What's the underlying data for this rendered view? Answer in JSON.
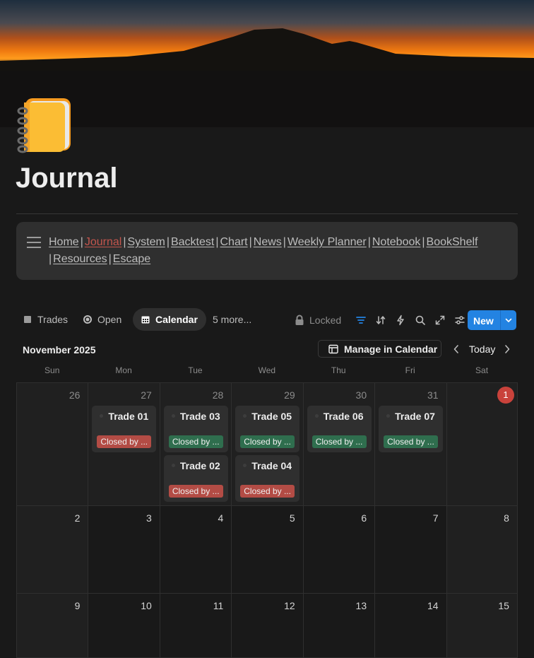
{
  "page": {
    "title": "Journal",
    "icon": "spiral-notebook-icon"
  },
  "nav_links": [
    {
      "label": "Home",
      "active": false
    },
    {
      "label": "Journal",
      "active": true
    },
    {
      "label": "System",
      "active": false
    },
    {
      "label": "Backtest",
      "active": false
    },
    {
      "label": "Chart",
      "active": false
    },
    {
      "label": "News",
      "active": false
    },
    {
      "label": "Weekly Planner",
      "active": false
    },
    {
      "label": "Notebook",
      "active": false
    },
    {
      "label": "BookShelf",
      "active": false
    },
    {
      "label": "Resources",
      "active": false
    },
    {
      "label": "Escape",
      "active": false
    }
  ],
  "nav_separator": "|",
  "views": {
    "tabs": [
      {
        "label": "Trades",
        "icon": "square-icon",
        "active": false
      },
      {
        "label": "Open",
        "icon": "circle-icon",
        "active": false
      },
      {
        "label": "Calendar",
        "icon": "calendar-icon",
        "active": true
      }
    ],
    "more_label": "5 more...",
    "locked_label": "Locked",
    "new_label": "New"
  },
  "calendar": {
    "month_label": "November 2025",
    "manage_label": "Manage in Calendar",
    "today_label": "Today",
    "weekdays": [
      "Sun",
      "Mon",
      "Tue",
      "Wed",
      "Thu",
      "Fri",
      "Sat"
    ],
    "weeks": [
      [
        {
          "day": "26",
          "muted": true,
          "today": false,
          "trades": []
        },
        {
          "day": "27",
          "muted": true,
          "today": false,
          "trades": [
            {
              "title": "Trade 01",
              "status": "Closed by ...",
              "status_color": "#b34c45"
            }
          ]
        },
        {
          "day": "28",
          "muted": true,
          "today": false,
          "trades": [
            {
              "title": "Trade 03",
              "status": "Closed by ...",
              "status_color": "#2f6e4e"
            },
            {
              "title": "Trade 02",
              "status": "Closed by ...",
              "status_color": "#b34c45"
            }
          ]
        },
        {
          "day": "29",
          "muted": true,
          "today": false,
          "trades": [
            {
              "title": "Trade 05",
              "status": "Closed by ...",
              "status_color": "#2f6e4e"
            },
            {
              "title": "Trade 04",
              "status": "Closed by ...",
              "status_color": "#b34c45"
            }
          ]
        },
        {
          "day": "30",
          "muted": true,
          "today": false,
          "trades": [
            {
              "title": "Trade 06",
              "status": "Closed by ...",
              "status_color": "#2f6e4e"
            }
          ]
        },
        {
          "day": "31",
          "muted": true,
          "today": false,
          "trades": [
            {
              "title": "Trade 07",
              "status": "Closed by ...",
              "status_color": "#2f6e4e"
            }
          ]
        },
        {
          "day": "1",
          "muted": false,
          "today": true,
          "trades": []
        }
      ],
      [
        {
          "day": "2",
          "muted": false,
          "today": false,
          "trades": []
        },
        {
          "day": "3",
          "muted": false,
          "today": false,
          "trades": []
        },
        {
          "day": "4",
          "muted": false,
          "today": false,
          "trades": []
        },
        {
          "day": "5",
          "muted": false,
          "today": false,
          "trades": []
        },
        {
          "day": "6",
          "muted": false,
          "today": false,
          "trades": []
        },
        {
          "day": "7",
          "muted": false,
          "today": false,
          "trades": []
        },
        {
          "day": "8",
          "muted": false,
          "today": false,
          "trades": []
        }
      ],
      [
        {
          "day": "9",
          "muted": false,
          "today": false,
          "trades": []
        },
        {
          "day": "10",
          "muted": false,
          "today": false,
          "trades": []
        },
        {
          "day": "11",
          "muted": false,
          "today": false,
          "trades": []
        },
        {
          "day": "12",
          "muted": false,
          "today": false,
          "trades": []
        },
        {
          "day": "13",
          "muted": false,
          "today": false,
          "trades": []
        },
        {
          "day": "14",
          "muted": false,
          "today": false,
          "trades": []
        },
        {
          "day": "15",
          "muted": false,
          "today": false,
          "trades": []
        }
      ]
    ]
  },
  "colors": {
    "accent": "#2383e2",
    "background": "#191919",
    "today_marker": "#c9423b",
    "active_link": "#c4554d"
  }
}
